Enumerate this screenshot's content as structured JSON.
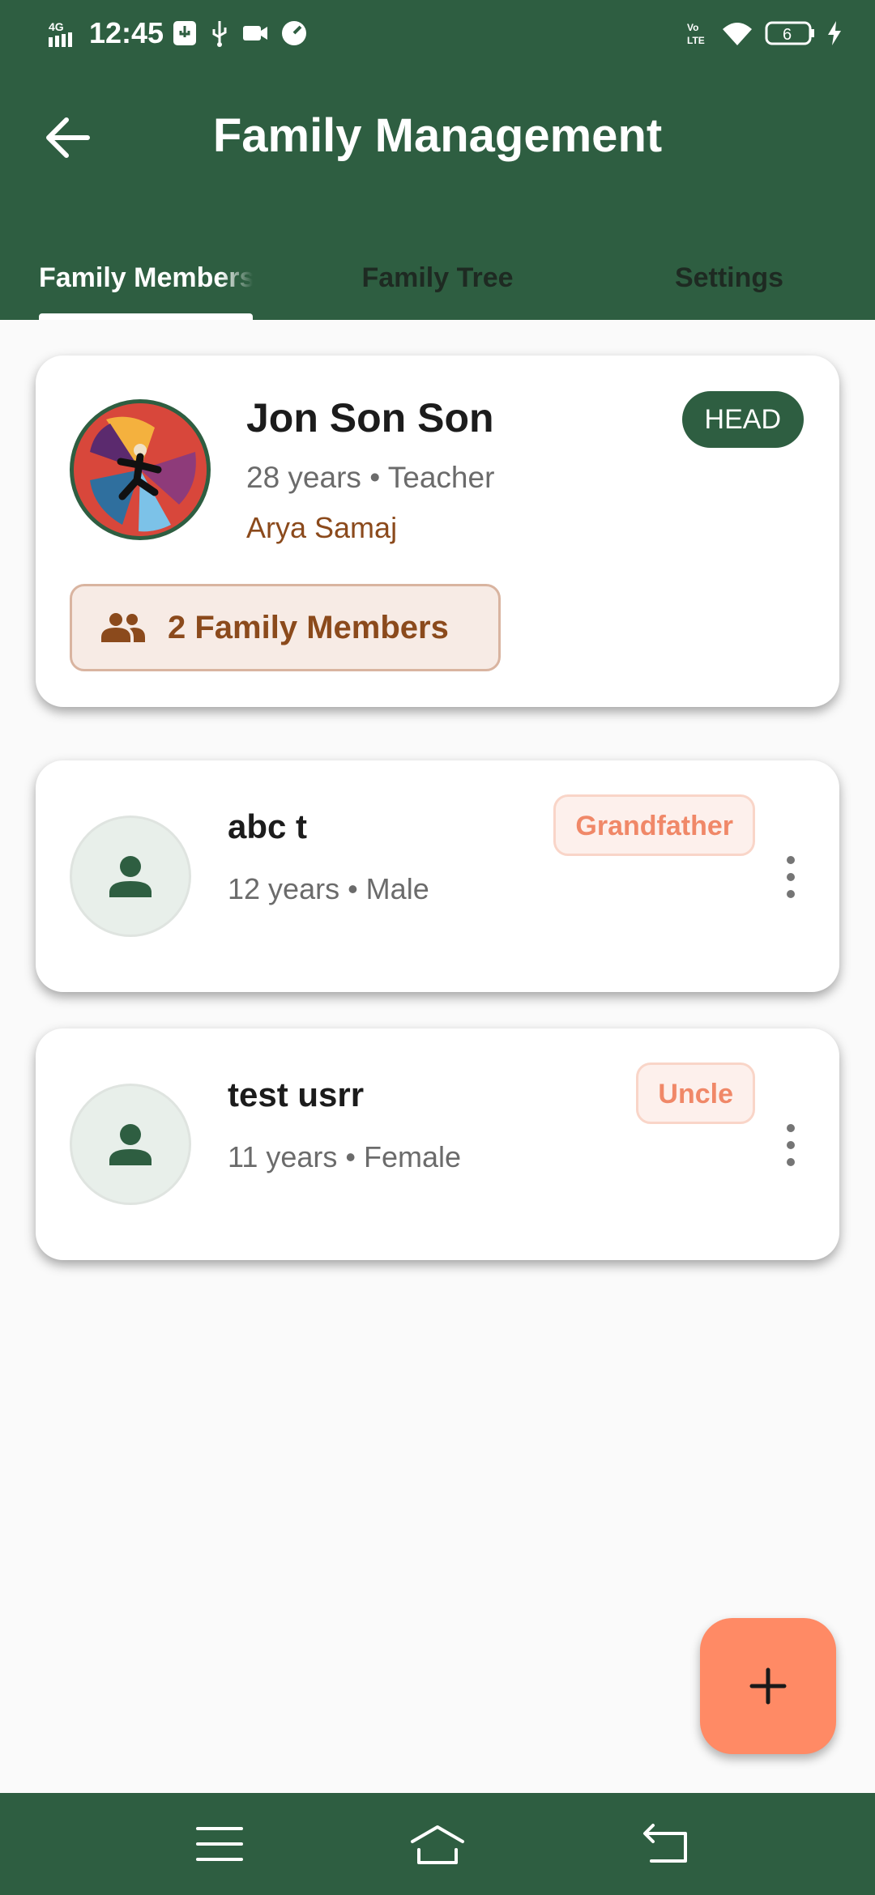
{
  "status_bar": {
    "time": "12:45",
    "network": "4G",
    "battery": "6",
    "icons": [
      "usb-settings-icon",
      "usb-icon",
      "video-record-icon",
      "speed-icon",
      "volte-icon",
      "wifi-icon",
      "battery-icon",
      "charging-icon"
    ]
  },
  "app_bar": {
    "title": "Family Management",
    "back_icon": "arrow-left-icon"
  },
  "tabs": [
    {
      "label": "Family Members",
      "active": true
    },
    {
      "label": "Family Tree",
      "active": false
    },
    {
      "label": "Settings",
      "active": false
    }
  ],
  "head": {
    "name": "Jon Son Son",
    "subtitle": "28 years • Teacher",
    "samaj": "Arya Samaj",
    "badge": "HEAD",
    "family_count_label": "2 Family Members"
  },
  "members": [
    {
      "name": "abc t",
      "subtitle": "12 years • Male",
      "relation": "Grandfather"
    },
    {
      "name": "test usrr",
      "subtitle": "11 years • Female",
      "relation": "Uncle"
    }
  ],
  "colors": {
    "primary": "#2e5e41",
    "accent": "#ff8a65",
    "brown": "#8b4a1c",
    "relation": "#f08868"
  },
  "fab_icon": "plus-icon",
  "nav_icons": [
    "menu-icon",
    "home-icon",
    "back-nav-icon"
  ]
}
